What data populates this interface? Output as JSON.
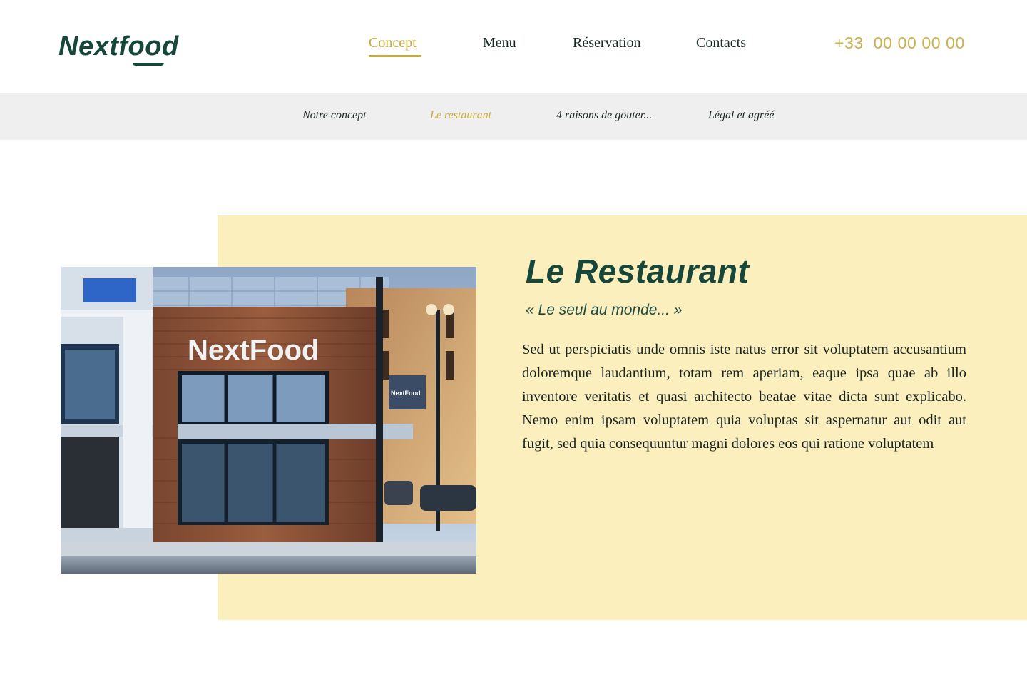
{
  "brand": {
    "name": "Nextfood"
  },
  "nav": {
    "items": [
      {
        "label": "Concept",
        "active": true
      },
      {
        "label": "Menu",
        "active": false
      },
      {
        "label": "Réservation",
        "active": false
      },
      {
        "label": "Contacts",
        "active": false
      }
    ],
    "phone": "+33  00 00 00 00"
  },
  "subnav": {
    "items": [
      {
        "label": "Notre concept",
        "active": false
      },
      {
        "label": "Le restaurant",
        "active": true
      },
      {
        "label": "4 raisons de gouter...",
        "active": false
      },
      {
        "label": "Légal et agréé",
        "active": false
      }
    ]
  },
  "section": {
    "title": "Le Restaurant",
    "quote": "« Le seul au monde... »",
    "body": "Sed ut perspiciatis unde omnis iste natus error sit voluptatem accusantium doloremque laudantium, totam rem aperiam, eaque ipsa quae ab illo inventore veritatis et quasi architecto beatae vitae dicta sunt explicabo. Nemo enim ipsam voluptatem quia voluptas sit aspernatur aut odit aut fugit, sed quia consequuntur magni dolores eos qui ratione voluptatem",
    "photo": {
      "sign_text": "NextFood",
      "banner_text": "NextFood"
    }
  },
  "colors": {
    "brand_green": "#17473a",
    "accent_gold": "#c9ad3e",
    "panel_yellow": "#fbf0bd",
    "subnav_gray": "#efefef"
  }
}
